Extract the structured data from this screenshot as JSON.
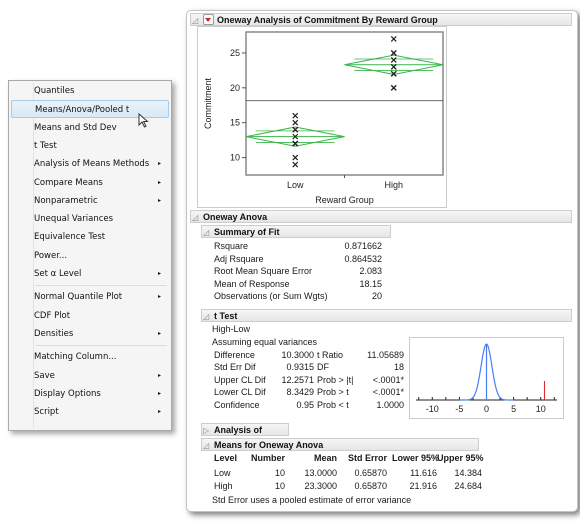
{
  "menu": {
    "items": [
      {
        "label": "Quantiles",
        "submenu": false
      },
      {
        "label": "Means/Anova/Pooled t",
        "submenu": false,
        "highlighted": true
      },
      {
        "label": "Means and Std Dev",
        "submenu": false
      },
      {
        "label": "t Test",
        "submenu": false
      },
      {
        "label": "Analysis of Means Methods",
        "submenu": true
      },
      {
        "label": "Compare Means",
        "submenu": true
      },
      {
        "label": "Nonparametric",
        "submenu": true
      },
      {
        "label": "Unequal Variances",
        "submenu": false
      },
      {
        "label": "Equivalence Test",
        "submenu": false
      },
      {
        "label": "Power...",
        "submenu": false
      },
      {
        "label": "Set α Level",
        "submenu": true
      },
      {
        "label": "Normal Quantile Plot",
        "submenu": true
      },
      {
        "label": "CDF Plot",
        "submenu": false
      },
      {
        "label": "Densities",
        "submenu": true
      },
      {
        "label": "Matching Column...",
        "submenu": false
      },
      {
        "label": "Save",
        "submenu": true
      },
      {
        "label": "Display Options",
        "submenu": true
      },
      {
        "label": "Script",
        "submenu": true
      }
    ],
    "submenu_arrow": "▸"
  },
  "report": {
    "title": "Oneway Analysis of Commitment By Reward Group",
    "oneway_anova_title": "Oneway Anova",
    "summary_of_fit": {
      "title": "Summary of Fit",
      "rows": [
        {
          "label": "Rsquare",
          "value": "0.871662"
        },
        {
          "label": "Adj Rsquare",
          "value": "0.864532"
        },
        {
          "label": "Root Mean Square Error",
          "value": "2.083"
        },
        {
          "label": "Mean of Response",
          "value": "18.15"
        },
        {
          "label": "Observations (or Sum Wgts)",
          "value": "20"
        }
      ]
    },
    "t_test": {
      "title": "t Test",
      "comparison": "High-Low",
      "assumption": "Assuming equal variances",
      "rows": [
        {
          "l1": "Difference",
          "v1": "10.3000",
          "l2": "t Ratio",
          "v2": "11.05689"
        },
        {
          "l1": "Std Err Dif",
          "v1": "0.9315",
          "l2": "DF",
          "v2": "18"
        },
        {
          "l1": "Upper CL Dif",
          "v1": "12.2571",
          "l2": "Prob > |t|",
          "v2": "<.0001*"
        },
        {
          "l1": "Lower CL Dif",
          "v1": "8.3429",
          "l2": "Prob > t",
          "v2": "<.0001*"
        },
        {
          "l1": "Confidence",
          "v1": "0.95",
          "l2": "Prob < t",
          "v2": "1.0000"
        }
      ],
      "dist_plot": {
        "ticks": [
          "-10",
          "-5",
          "0",
          "5",
          "10"
        ],
        "t_ratio": 11.05689,
        "xlim": [
          -13,
          13
        ]
      }
    },
    "analysis_of_variance_title": "Analysis of Variance",
    "means": {
      "title": "Means for Oneway Anova",
      "headers": [
        "Level",
        "Number",
        "Mean",
        "Std Error",
        "Lower 95%",
        "Upper 95%"
      ],
      "rows": [
        [
          "Low",
          "10",
          "13.0000",
          "0.65870",
          "11.616",
          "14.384"
        ],
        [
          "High",
          "10",
          "23.3000",
          "0.65870",
          "21.916",
          "24.684"
        ]
      ],
      "note": "Std Error uses a pooled estimate of error variance"
    }
  },
  "chart_data": {
    "type": "scatter",
    "title": "",
    "xlabel": "Reward Group",
    "ylabel": "Commitment",
    "categories": [
      "Low",
      "High"
    ],
    "y_ticks": [
      10,
      15,
      20,
      25
    ],
    "ylim": [
      7.5,
      28
    ],
    "grand_mean": 18.15,
    "series": [
      {
        "name": "Low",
        "values": [
          16,
          15,
          14,
          14,
          13,
          12,
          12,
          12,
          10,
          9
        ],
        "mean": 13.0,
        "lower95": 11.616,
        "upper95": 14.384
      },
      {
        "name": "High",
        "values": [
          27,
          25,
          25,
          24,
          23,
          23,
          22,
          22,
          20,
          20
        ],
        "mean": 23.3,
        "lower95": 21.916,
        "upper95": 24.684
      }
    ],
    "colors": {
      "diamond": "#3cb44b",
      "points": "#222222",
      "mean_line": "#555555"
    }
  }
}
